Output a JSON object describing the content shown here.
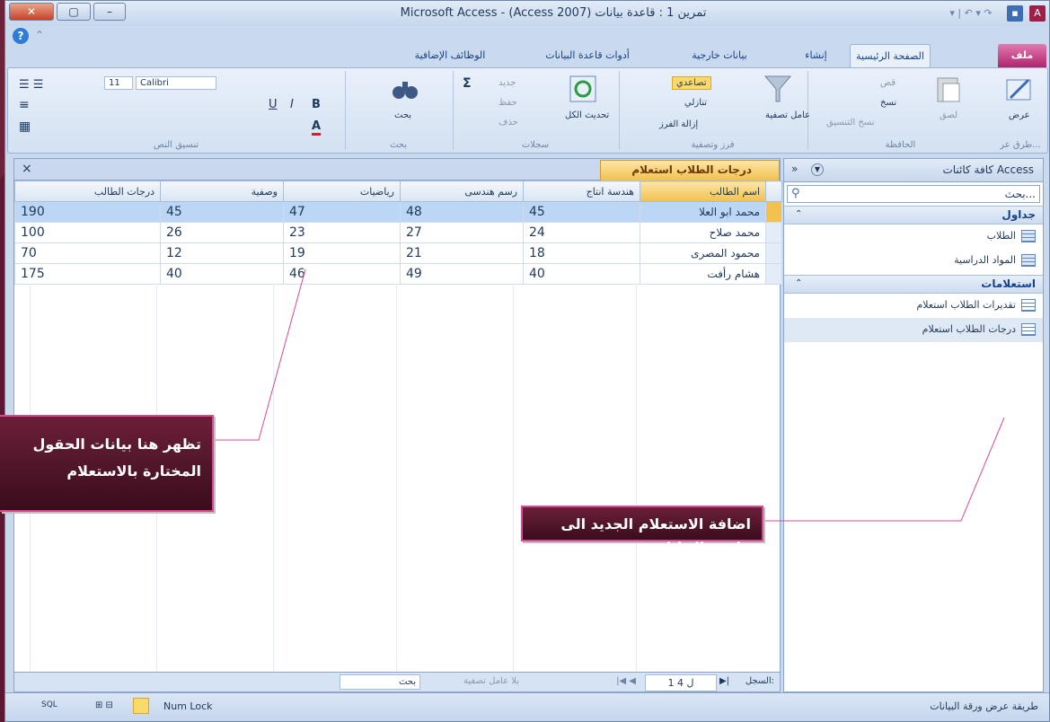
{
  "window": {
    "title": "Microsoft Access - (Access 2007) تمرين 1 : قاعدة بيانات",
    "qat_app": "A"
  },
  "tabs": [
    "ملف",
    "الصفحة الرئيسية",
    "إنشاء",
    "بيانات خارجية",
    "أدوات قاعدة البيانات",
    "الوظائف الإضافية"
  ],
  "ribbon": {
    "groups": [
      "طرق عر...",
      "الحافظة",
      "فرز وتصفية",
      "سجلات",
      "بحث",
      "تنسيق النص"
    ],
    "view": "عرض",
    "clipboard": {
      "paste": "لصق",
      "cut": "قص",
      "copy": "نسخ",
      "format": "نسخ التنسيق"
    },
    "sort": {
      "filter": "عامل تصفية",
      "asc": "تصاعدي",
      "desc": "تنازلي",
      "clear": "إزالة الفرز"
    },
    "records": {
      "refresh": "تحديث الكل",
      "new": "جديد",
      "save": "حفظ",
      "delete": "حذف",
      "totals": "Σ"
    },
    "find": {
      "find": "بحث"
    },
    "text": {
      "font": "Calibri",
      "size": "11",
      "bold": "B",
      "italic": "I",
      "underline": "U",
      "fontcolor": "A"
    }
  },
  "objpane": {
    "title": "كافة كائنات Access",
    "search_placeholder": "بحث...",
    "sections": [
      {
        "name": "جداول",
        "items": [
          "الطلاب",
          "المواد الدراسية"
        ]
      },
      {
        "name": "استعلامات",
        "items": [
          "تقديرات الطلاب استعلام",
          "درجات الطلاب استعلام"
        ]
      }
    ]
  },
  "doc": {
    "tab": "درجات الطلاب استعلام",
    "close": "×",
    "columns": [
      "اسم الطالب",
      "هندسة انتاج",
      "رسم هندسى",
      "رياضيات",
      "وصفية",
      "درجات الطالب"
    ],
    "rows": [
      {
        "name": "محمد ابو العلا",
        "v": [
          "45",
          "48",
          "47",
          "45",
          "190"
        ]
      },
      {
        "name": "محمد صلاح",
        "v": [
          "24",
          "27",
          "23",
          "26",
          "100"
        ]
      },
      {
        "name": "محمود المصرى",
        "v": [
          "18",
          "21",
          "19",
          "12",
          "70"
        ]
      },
      {
        "name": "هشام رأفت",
        "v": [
          "40",
          "49",
          "46",
          "40",
          "175"
        ]
      }
    ],
    "recbar": {
      "label": "السجل:",
      "pos": "1 ل 4",
      "filter": "بلا عامل تصفية",
      "search": "بحث"
    }
  },
  "status": {
    "view": "طريقة عرض ورقة البيانات",
    "numlock": "Num Lock",
    "sql": "SQL"
  },
  "callouts": {
    "left": "تظهر هنا بيانات الحقول المختارة بالاستعلام",
    "right": "اضافة الاستعلام الجديد الى قاعدة البيانات"
  }
}
